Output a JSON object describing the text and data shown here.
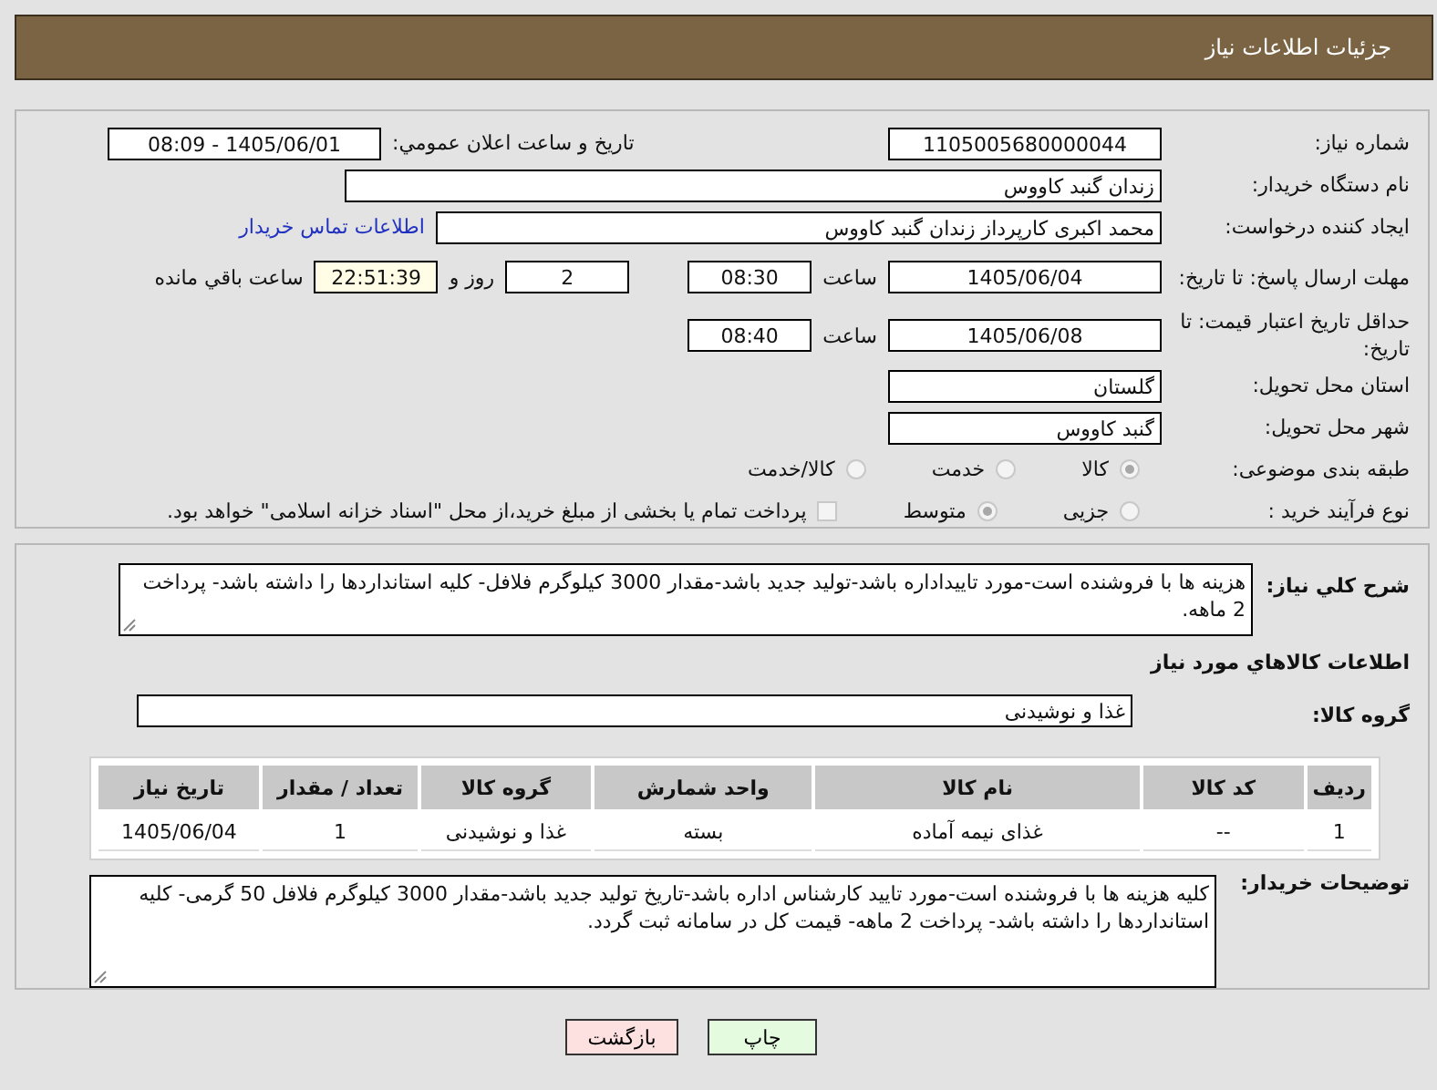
{
  "header": {
    "title": "جزئیات اطلاعات نیاز"
  },
  "need_number": {
    "label": "شماره نیاز:",
    "value": "1105005680000044"
  },
  "announce": {
    "label": "تاریخ و ساعت اعلان عمومي:",
    "value": "1405/06/01 - 08:09"
  },
  "buyer": {
    "label": "نام دستگاه خریدار:",
    "value": "زندان گنبد کاووس"
  },
  "requester": {
    "label": "ایجاد کننده درخواست:",
    "value": "محمد اکبری کارپرداز زندان گنبد کاووس",
    "link": "اطلاعات تماس خریدار"
  },
  "deadline": {
    "label": "مهلت ارسال پاسخ: تا تاریخ:",
    "date": "1405/06/04",
    "time_label": "ساعت",
    "time": "08:30",
    "days": "2",
    "days_label": "روز و",
    "remaining": "22:51:39",
    "remaining_label": "ساعت باقي مانده"
  },
  "validity": {
    "label": "حداقل تاریخ اعتبار قیمت: تا تاریخ:",
    "date": "1405/06/08",
    "time_label": "ساعت",
    "time": "08:40"
  },
  "province": {
    "label": "استان محل تحویل:",
    "value": "گلستان"
  },
  "city": {
    "label": "شهر محل تحویل:",
    "value": "گنبد کاووس"
  },
  "category": {
    "label": "طبقه بندی موضوعی:",
    "options": [
      {
        "label": "کالا",
        "selected": true
      },
      {
        "label": "خدمت",
        "selected": false
      },
      {
        "label": "کالا/خدمت",
        "selected": false
      }
    ]
  },
  "purchase_type": {
    "label": "نوع فرآیند خرید :",
    "options": [
      {
        "label": "جزیی",
        "selected": false
      },
      {
        "label": "متوسط",
        "selected": true
      }
    ],
    "treasury": {
      "checked": false,
      "text": "پرداخت تمام یا بخشی از مبلغ خرید،از محل \"اسناد خزانه اسلامی\" خواهد بود."
    }
  },
  "description": {
    "label": "شرح کلي نیاز:",
    "text": "هزینه ها با فروشنده است-مورد تاییداداره باشد-تولید جدید باشد-مقدار 3000 کیلوگرم فلافل- کلیه استانداردها را داشته باشد- پرداخت 2 ماهه."
  },
  "goods_title": "اطلاعات کالاهاي مورد نیاز",
  "goods_group": {
    "label": "گروه کالا:",
    "value": "غذا و نوشیدنی"
  },
  "table": {
    "columns": [
      "ردیف",
      "کد کالا",
      "نام کالا",
      "واحد شمارش",
      "گروه کالا",
      "تعداد / مقدار",
      "تاریخ نیاز"
    ],
    "rows": [
      [
        "1",
        "--",
        "غذای نیمه آماده",
        "بسته",
        "غذا و نوشیدنی",
        "1",
        "1405/06/04"
      ]
    ]
  },
  "notes": {
    "label": "توضیحات خریدار:",
    "text": "کلیه هزینه ها با فروشنده است-مورد تایید کارشناس اداره باشد-تاریخ تولید جدید باشد-مقدار 3000 کیلوگرم فلافل 50 گرمی- کلیه استانداردها را داشته باشد- پرداخت 2 ماهه- قیمت کل در سامانه ثبت گردد."
  },
  "buttons": [
    {
      "label": "چاپ",
      "color": "#e4fbdf"
    },
    {
      "label": "بازگشت",
      "color": "#fde0e0"
    }
  ]
}
